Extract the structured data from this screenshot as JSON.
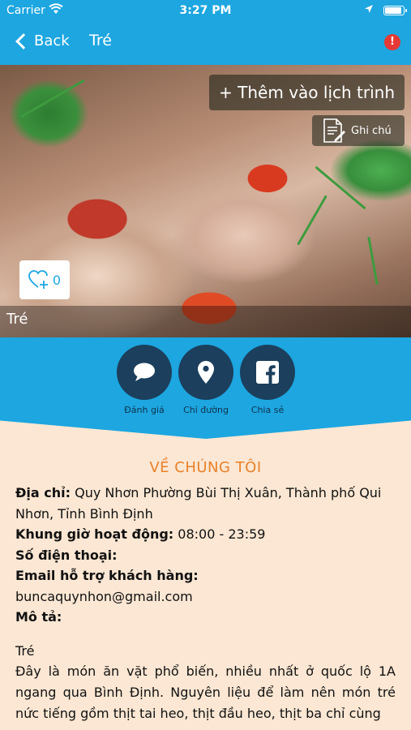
{
  "status_bar": {
    "carrier": "Carrier",
    "time": "3:27 PM",
    "battery_level": 0.95
  },
  "nav": {
    "back_label": "Back",
    "title": "Tré",
    "alert_symbol": "!"
  },
  "hero": {
    "add_itinerary_label": "+ Thêm vào lịch trình",
    "note_label": "Ghi chú",
    "likes": "0",
    "caption": "Tré"
  },
  "actions": [
    {
      "label": "Đánh giá",
      "icon": "chat-bubble-icon"
    },
    {
      "label": "Chỉ đường",
      "icon": "map-pin-icon"
    },
    {
      "label": "Chia sẻ",
      "icon": "facebook-icon"
    }
  ],
  "about": {
    "heading": "VỀ CHÚNG TÔI",
    "address_key": "Địa chỉ:",
    "address_value": " Quy Nhơn Phường Bùi Thị Xuân, Thành phố Qui",
    "address_cont": "Nhơn, Tỉnh Bình Định",
    "hours_key": "Khung giờ hoạt động:",
    "hours_value": " 08:00 - 23:59",
    "phone_key": "Số điện thoại:",
    "email_key": "Email hỗ trợ khách hàng:",
    "email_value": "buncaquynhon@gmail.com",
    "desc_key": "Mô tả:",
    "desc_title": "Tré",
    "desc_text": "Đây là món ăn vặt phổ biến, nhiều nhất ở quốc lộ 1A ngang qua Bình Định. Nguyên liệu để làm nên món tré nức tiếng gồm thịt tai heo, thịt đầu heo, thịt ba chỉ cùng"
  },
  "colors": {
    "primary": "#1da6e0",
    "action_circle": "#1b3f5c",
    "heading": "#e8812a",
    "background": "#fbe7d3",
    "alert": "#e53935"
  }
}
